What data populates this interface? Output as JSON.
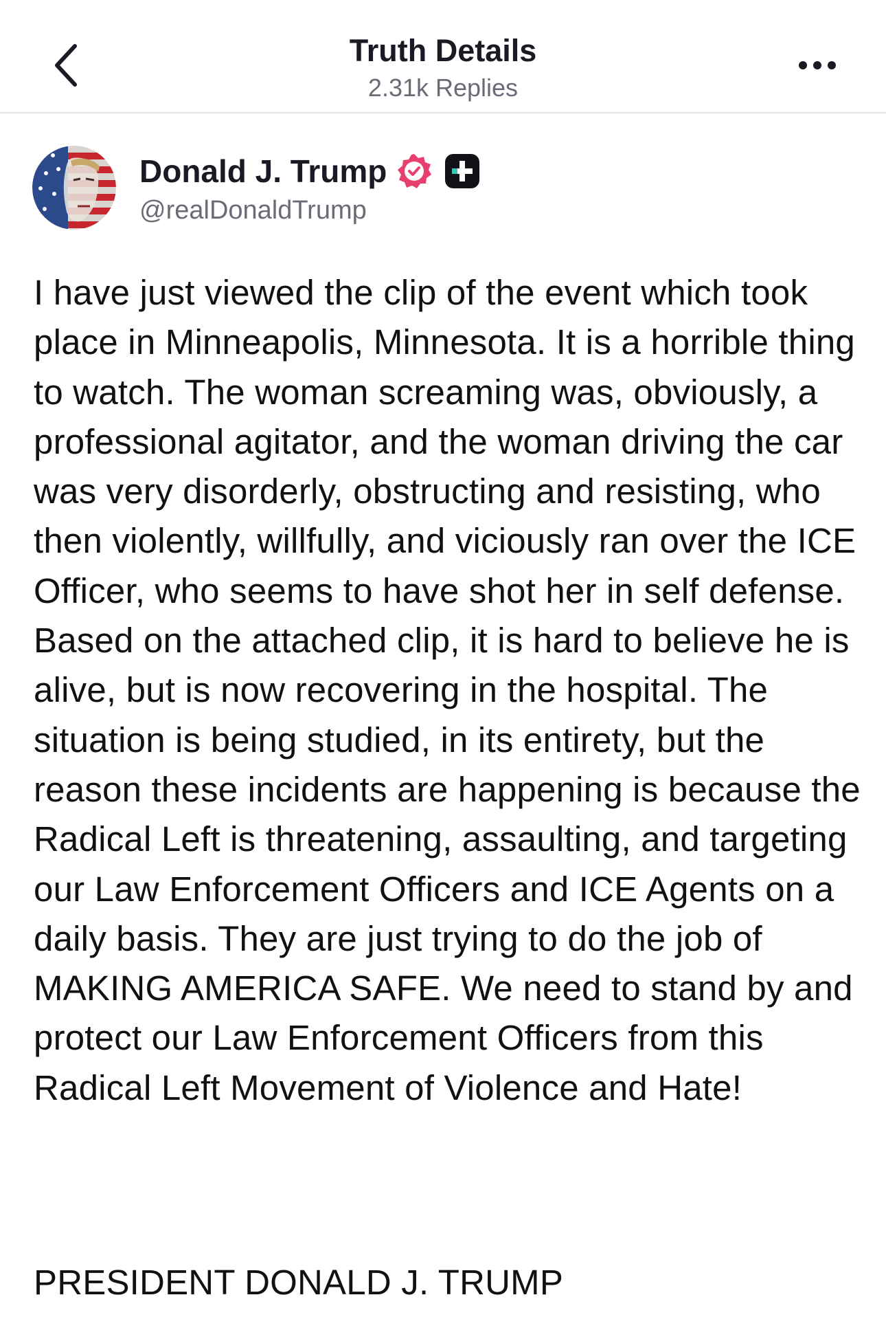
{
  "header": {
    "title": "Truth Details",
    "subtitle": "2.31k Replies",
    "back_icon": "chevron-left-icon",
    "more_icon": "more-horizontal-icon"
  },
  "author": {
    "display_name": "Donald J. Trump",
    "handle": "@realDonaldTrump",
    "verified_icon": "verified-badge-icon",
    "verified_color": "#e8406e",
    "plus_icon": "truth-plus-badge-icon"
  },
  "post": {
    "body": "I have just viewed the clip of the event which took place in Minneapolis, Minnesota. It is a horrible thing to watch. The woman screaming was, obviously, a professional agitator, and the woman driving the car was very disorderly, obstructing and resisting, who then violently, willfully, and viciously ran over the ICE Officer, who seems to have shot her in self defense. Based on the attached clip, it is hard to believe he is alive, but is now recovering in the hospital. The situation is being studied, in its entirety, but the reason these incidents are happening is because the Radical Left is threatening, assaulting, and targeting our Law Enforcement Officers and ICE Agents on a daily basis. They are just trying to do the job of MAKING AMERICA SAFE. We need to stand by and protect our Law Enforcement Officers from this Radical Left Movement of Violence and Hate!",
    "signature": "PRESIDENT DONALD J. TRUMP"
  }
}
